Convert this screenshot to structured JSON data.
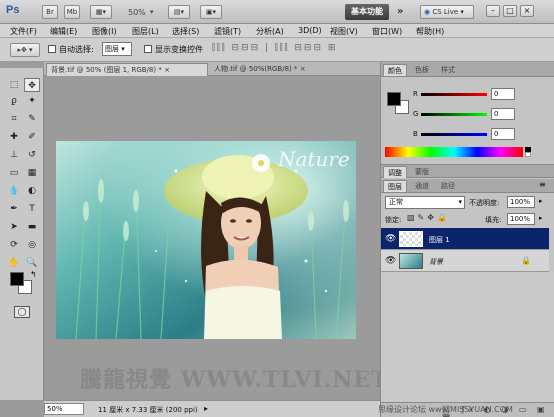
{
  "app": {
    "logo": "Ps",
    "top_buttons": [
      "Br",
      "Mb"
    ],
    "zoom": "50%",
    "workspace": "基本功能",
    "more": "»",
    "cs_live": "CS Live",
    "window_controls": [
      "–",
      "□",
      "×"
    ]
  },
  "menu": [
    "文件(F)",
    "编辑(E)",
    "图像(I)",
    "图层(L)",
    "选择(S)",
    "滤镜(T)",
    "分析(A)",
    "3D(D)",
    "视图(V)",
    "窗口(W)",
    "帮助(H)"
  ],
  "options": {
    "auto_select_label": "自动选择:",
    "auto_select_value": "图层",
    "show_transform_label": "显示变换控件"
  },
  "document_tabs": [
    {
      "label": "背景.tif @ 50% (图层 1, RGB/8) *",
      "active": true
    },
    {
      "label": "人物.tif @ 50%(RGB/8) *",
      "active": false
    }
  ],
  "image_text": "Nature",
  "watermark": "騰龍視覺 WWW.TLVI.NET",
  "status": {
    "zoom": "50%",
    "doc_info": "11 厘米 x 7.33 厘米 (200 ppi)"
  },
  "color_panel": {
    "tabs": [
      "颜色",
      "色板",
      "样式"
    ],
    "channels": [
      {
        "label": "R",
        "value": "0",
        "color": "#e00000"
      },
      {
        "label": "G",
        "value": "0",
        "color": "#00b000"
      },
      {
        "label": "B",
        "value": "0",
        "color": "#0000e0"
      }
    ]
  },
  "adjust_tabs": [
    "调整",
    "蒙版"
  ],
  "layers_panel": {
    "tabs": [
      "图层",
      "通道",
      "路径"
    ],
    "blend_mode": "正常",
    "opacity_label": "不透明度:",
    "opacity_value": "100%",
    "lock_label": "锁定:",
    "fill_label": "填充:",
    "fill_value": "100%",
    "layers": [
      {
        "name": "图层 1",
        "selected": true,
        "locked": false
      },
      {
        "name": "背景",
        "selected": false,
        "locked": true
      }
    ]
  },
  "bottom_watermark": "思缘设计论坛 www.MISSYUAN.COM",
  "colors": {
    "selection": "#0b246b",
    "foreground": "#000000",
    "background": "#ffffff"
  }
}
